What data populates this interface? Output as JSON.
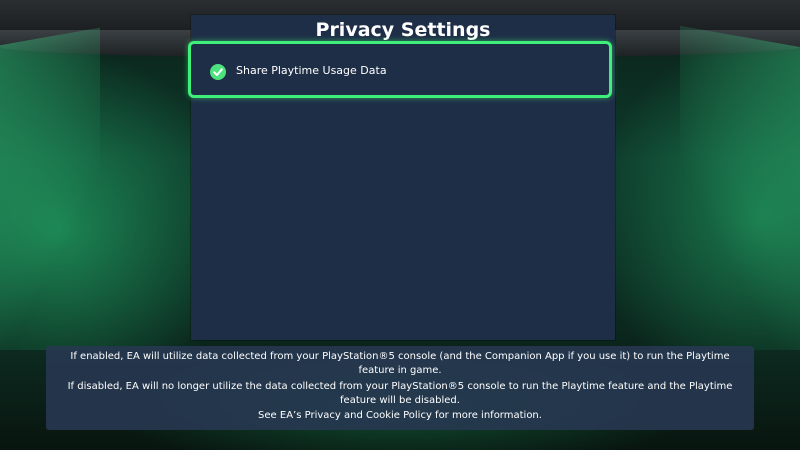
{
  "screen": {
    "title": "Privacy Settings"
  },
  "options": [
    {
      "label": "Share Playtime Usage Data",
      "checked": true,
      "selected": true,
      "icon": "check-circle-icon"
    }
  ],
  "info": {
    "lines": [
      "If enabled, EA will utilize data collected from your PlayStation®5 console (and the Companion App if you use it) to run the Playtime",
      "feature in game.",
      "If disabled, EA will no longer utilize the data collected from your PlayStation®5 console to run the Playtime feature and the Playtime",
      "feature will be disabled.",
      "See EA’s Privacy and Cookie Policy for more information."
    ]
  },
  "colors": {
    "panel_background": "#1f2e47",
    "selection_border": "#3ef07a",
    "check_fill": "#4ee27e",
    "text": "#ffffff"
  }
}
